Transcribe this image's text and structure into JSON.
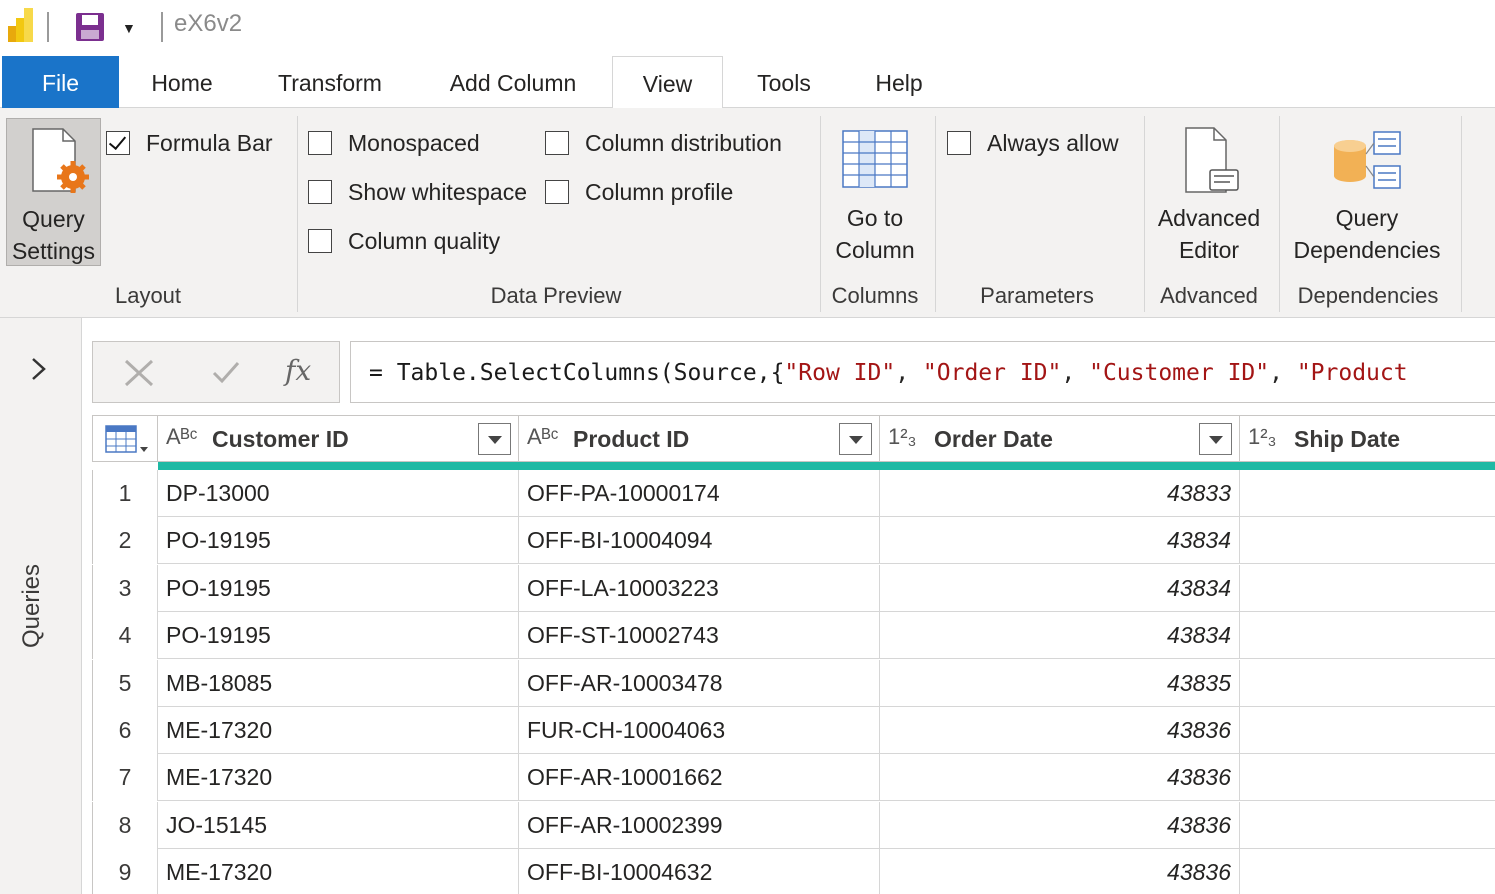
{
  "title_bar": {
    "doc_title": "eX6v2"
  },
  "tabs": [
    {
      "label": "File"
    },
    {
      "label": "Home"
    },
    {
      "label": "Transform"
    },
    {
      "label": "Add Column"
    },
    {
      "label": "View"
    },
    {
      "label": "Tools"
    },
    {
      "label": "Help"
    }
  ],
  "active_tab": "View",
  "ribbon": {
    "layout": {
      "query_settings_line1": "Query",
      "query_settings_line2": "Settings",
      "formula_bar_label": "Formula Bar",
      "formula_bar_checked": true,
      "group_label": "Layout"
    },
    "data_preview": {
      "monospaced": "Monospaced",
      "show_whitespace": "Show whitespace",
      "column_quality": "Column quality",
      "column_distribution": "Column distribution",
      "column_profile": "Column profile",
      "group_label": "Data Preview"
    },
    "columns": {
      "go_to_line1": "Go to",
      "go_to_line2": "Column",
      "group_label": "Columns"
    },
    "parameters": {
      "always_allow": "Always allow",
      "group_label": "Parameters"
    },
    "advanced": {
      "line1": "Advanced",
      "line2": "Editor",
      "group_label": "Advanced"
    },
    "dependencies": {
      "line1": "Query",
      "line2": "Dependencies",
      "group_label": "Dependencies"
    }
  },
  "left_pane": {
    "label": "Queries"
  },
  "formula_bar": {
    "fx_label": "fx",
    "prefix": "= Table.SelectColumns(Source,{",
    "s1": "\"Row ID\"",
    "s2": "\"Order ID\"",
    "s3": "\"Customer ID\"",
    "s4": "\"Product",
    "sep": ", "
  },
  "table": {
    "columns": [
      {
        "type": "ABC",
        "name": "Customer ID"
      },
      {
        "type": "123",
        "name": "Product ID"
      },
      {
        "type": "123",
        "name": "Order Date"
      },
      {
        "type": "123",
        "name": "Ship Date"
      }
    ],
    "col_types": [
      "Aᴮᶜ",
      "Aᴮᶜ",
      "1²₃",
      "1²₃"
    ],
    "rows": [
      {
        "n": "1",
        "customer": "DP-13000",
        "product": "OFF-PA-10000174",
        "order_date": "43833"
      },
      {
        "n": "2",
        "customer": "PO-19195",
        "product": "OFF-BI-10004094",
        "order_date": "43834"
      },
      {
        "n": "3",
        "customer": "PO-19195",
        "product": "OFF-LA-10003223",
        "order_date": "43834"
      },
      {
        "n": "4",
        "customer": "PO-19195",
        "product": "OFF-ST-10002743",
        "order_date": "43834"
      },
      {
        "n": "5",
        "customer": "MB-18085",
        "product": "OFF-AR-10003478",
        "order_date": "43835"
      },
      {
        "n": "6",
        "customer": "ME-17320",
        "product": "FUR-CH-10004063",
        "order_date": "43836"
      },
      {
        "n": "7",
        "customer": "ME-17320",
        "product": "OFF-AR-10001662",
        "order_date": "43836"
      },
      {
        "n": "8",
        "customer": "JO-15145",
        "product": "OFF-AR-10002399",
        "order_date": "43836"
      },
      {
        "n": "9",
        "customer": "ME-17320",
        "product": "OFF-BI-10004632",
        "order_date": "43836"
      }
    ]
  },
  "colors": {
    "accent": "#1a74c9",
    "quality_bar": "#1eb9a4",
    "string_literal": "#a31515"
  }
}
